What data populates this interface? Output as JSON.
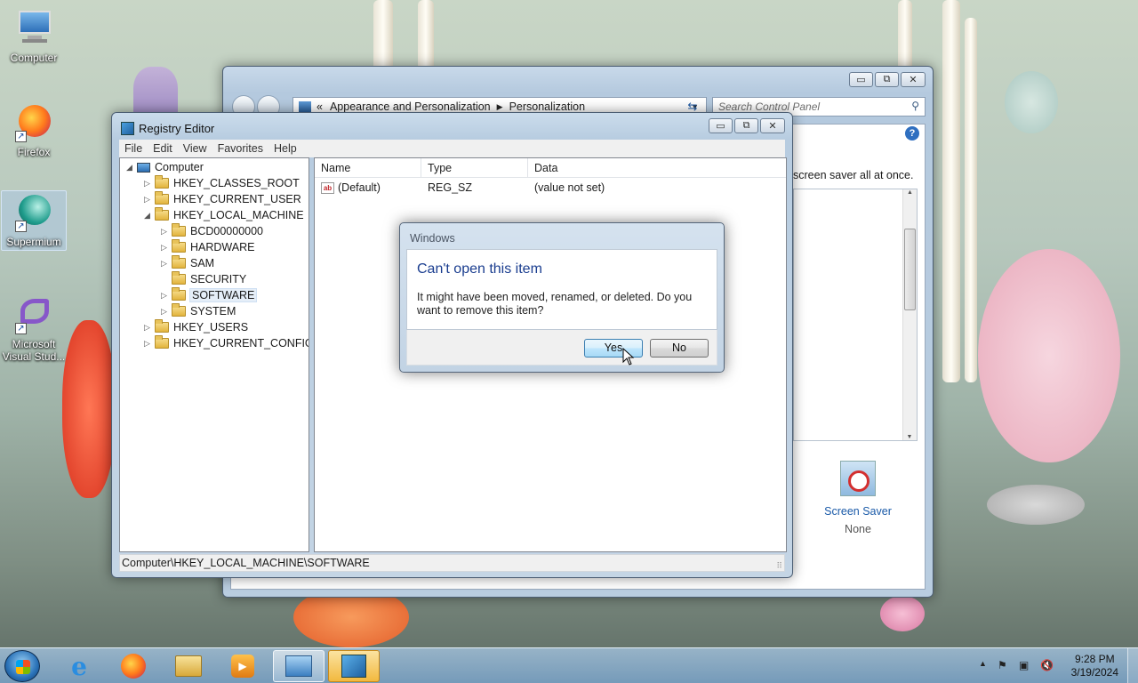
{
  "desktop": {
    "icons": [
      {
        "label": "Computer"
      },
      {
        "label": "Firefox"
      },
      {
        "label": "Supermium"
      },
      {
        "label": "Microsoft Visual Stud..."
      }
    ]
  },
  "control_panel": {
    "address_prefix": "«",
    "breadcrumb": [
      "Appearance and Personalization",
      "Personalization"
    ],
    "search_placeholder": "Search Control Panel",
    "help_glyph": "?",
    "snippet_text": "screen saver all at once.",
    "screen_saver_label": "Screen Saver",
    "screen_saver_value": "None"
  },
  "registry_editor": {
    "title": "Registry Editor",
    "menu": [
      "File",
      "Edit",
      "View",
      "Favorites",
      "Help"
    ],
    "tree": [
      {
        "label": "Computer",
        "level": 0,
        "expander": "◢"
      },
      {
        "label": "HKEY_CLASSES_ROOT",
        "level": 1,
        "expander": "▷"
      },
      {
        "label": "HKEY_CURRENT_USER",
        "level": 1,
        "expander": "▷"
      },
      {
        "label": "HKEY_LOCAL_MACHINE",
        "level": 1,
        "expander": "◢"
      },
      {
        "label": "BCD00000000",
        "level": 2,
        "expander": "▷"
      },
      {
        "label": "HARDWARE",
        "level": 2,
        "expander": "▷"
      },
      {
        "label": "SAM",
        "level": 2,
        "expander": "▷"
      },
      {
        "label": "SECURITY",
        "level": 2,
        "expander": ""
      },
      {
        "label": "SOFTWARE",
        "level": 2,
        "expander": "▷",
        "selected": true
      },
      {
        "label": "SYSTEM",
        "level": 2,
        "expander": "▷"
      },
      {
        "label": "HKEY_USERS",
        "level": 1,
        "expander": "▷"
      },
      {
        "label": "HKEY_CURRENT_CONFIG",
        "level": 1,
        "expander": "▷"
      }
    ],
    "columns": [
      "Name",
      "Type",
      "Data"
    ],
    "rows": [
      {
        "name": "(Default)",
        "type": "REG_SZ",
        "data": "(value not set)"
      }
    ],
    "status_path": "Computer\\HKEY_LOCAL_MACHINE\\SOFTWARE"
  },
  "dialog": {
    "window_title": "Windows",
    "heading": "Can't open this item",
    "message": "It might have been moved, renamed, or deleted. Do you want to remove this item?",
    "yes_label": "Yes",
    "no_label": "No"
  },
  "taskbar": {
    "time": "9:28 PM",
    "date": "3/19/2024"
  },
  "colors": {
    "dialog_heading": "#1a3d8f",
    "taskbar": "#8fb2cf",
    "selection": "#e5eef8"
  }
}
